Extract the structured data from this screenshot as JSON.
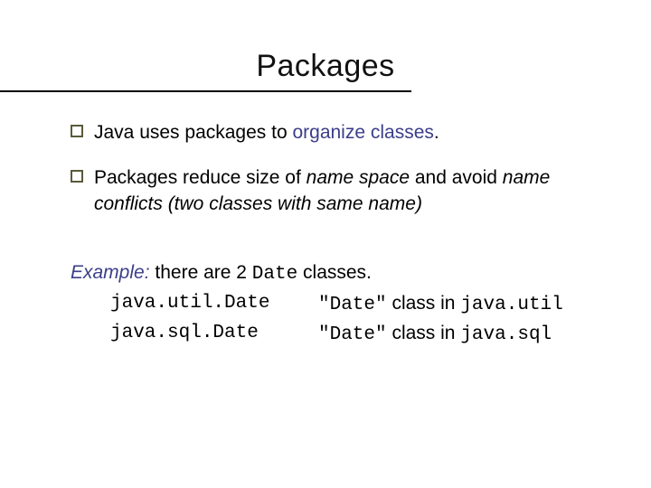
{
  "title": "Packages",
  "bullets": [
    {
      "pre": "Java uses packages to ",
      "accent": "organize classes",
      "post": "."
    },
    {
      "pre": "Packages reduce size of ",
      "italic1": "name space",
      "mid": " and avoid ",
      "italic2": "name conflicts (two classes with same name)"
    }
  ],
  "example": {
    "label": "Example:",
    "intro_pre": "  there are 2 ",
    "intro_code": "Date",
    "intro_post": " classes.",
    "rows": [
      {
        "left": "java.util.Date",
        "rt_pre": "\"Date\"",
        "rt_mid": " class in ",
        "rt_code": "java.util"
      },
      {
        "left": "java.sql.Date",
        "rt_pre": "\"Date\"",
        "rt_mid": " class in ",
        "rt_code": "java.sql"
      }
    ]
  }
}
